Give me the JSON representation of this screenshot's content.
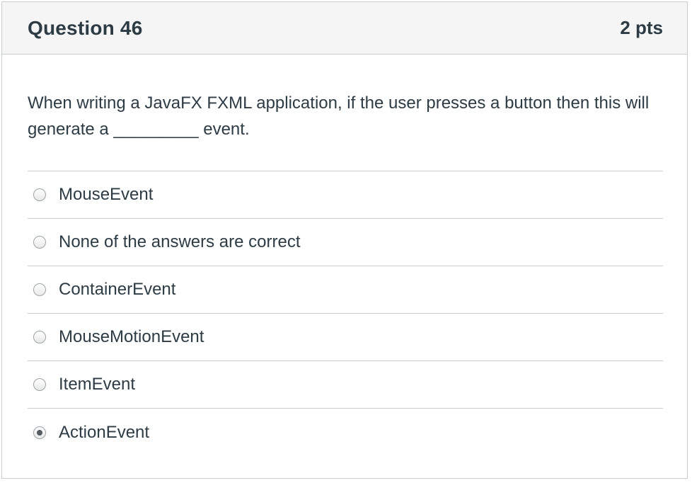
{
  "question": {
    "title": "Question 46",
    "points": "2 pts",
    "text": "When writing a JavaFX FXML application, if the user presses a button then this will generate a _________ event."
  },
  "answers": [
    {
      "label": "MouseEvent",
      "selected": false
    },
    {
      "label": "None of the answers are correct",
      "selected": false
    },
    {
      "label": "ContainerEvent",
      "selected": false
    },
    {
      "label": "MouseMotionEvent",
      "selected": false
    },
    {
      "label": "ItemEvent",
      "selected": false
    },
    {
      "label": "ActionEvent",
      "selected": true
    }
  ]
}
